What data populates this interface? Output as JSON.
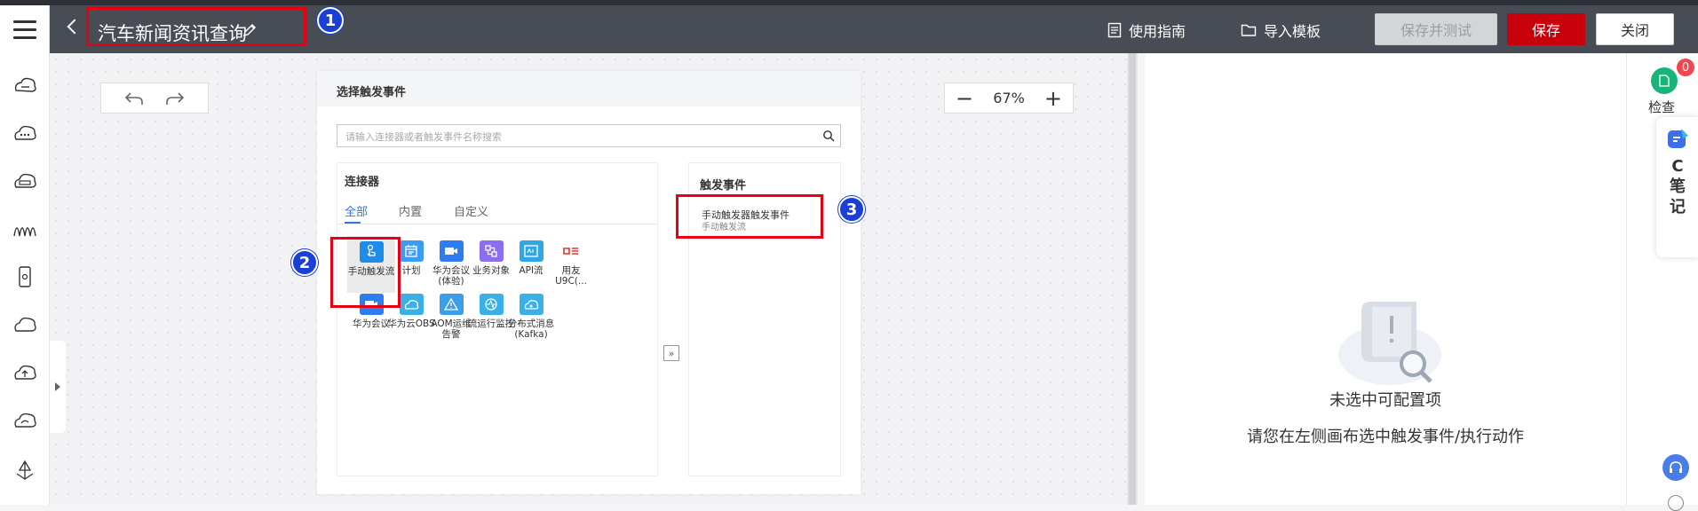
{
  "header": {
    "title": "汽车新闻资讯查询",
    "guide_label": "使用指南",
    "import_label": "导入模板",
    "save_test_label": "保存并测试",
    "save_label": "保存",
    "close_label": "关闭"
  },
  "annotations": [
    "1",
    "2",
    "3"
  ],
  "canvas": {
    "zoom": "67%"
  },
  "picker": {
    "title": "选择触发事件",
    "search_placeholder": "请输入连接器或者触发事件名称搜索",
    "connectors_title": "连接器",
    "tabs": [
      "全部",
      "内置",
      "自定义"
    ],
    "active_tab": "全部",
    "connectors": [
      {
        "label": "手动触发流",
        "color": "#1e8ce8",
        "icon": "hand-tap-icon"
      },
      {
        "label": "计划",
        "color": "#3a9cf2",
        "icon": "calendar-icon"
      },
      {
        "label": "华为会议(体验)",
        "color": "#2e7df0",
        "icon": "video-camera-icon"
      },
      {
        "label": "业务对象",
        "color": "#8c6df2",
        "icon": "business-object-icon"
      },
      {
        "label": "API流",
        "color": "#2fa7e6",
        "icon": "api-icon"
      },
      {
        "label": "用友U9C(...",
        "color": "#e5322d",
        "icon": "yonyou-logo"
      },
      {
        "label": "华为会议",
        "color": "#2e7df0",
        "icon": "video-camera-icon"
      },
      {
        "label": "华为云OBS",
        "color": "#3ab0e9",
        "icon": "obs-cloud-icon"
      },
      {
        "label": "AOM运维告警",
        "color": "#3a9ee8",
        "icon": "alarm-triangle-icon"
      },
      {
        "label": "流运行监控",
        "color": "#3ab0e9",
        "icon": "monitor-icon"
      },
      {
        "label": "分布式消息(Kafka)",
        "color": "#3ab0e9",
        "icon": "kafka-cloud-icon"
      }
    ],
    "expand_label": "»",
    "triggers_title": "触发事件",
    "trigger_name": "手动触发器触发事件",
    "trigger_sub": "手动触发流"
  },
  "properties": {
    "empty_title": "未选中可配置项",
    "empty_desc": "请您在左侧画布选中触发事件/执行动作"
  },
  "rightbar": {
    "check_count": "0",
    "check_label": "检查",
    "note_label": "C笔记"
  },
  "sidebar": {
    "icons": [
      "trigger-icon",
      "cloud-dots-icon",
      "cloud-code-icon",
      "flow-icon",
      "mobile-icon",
      "cloud-icon",
      "cloud-upload-icon",
      "cloud-sync-icon",
      "anchor-icon"
    ]
  }
}
